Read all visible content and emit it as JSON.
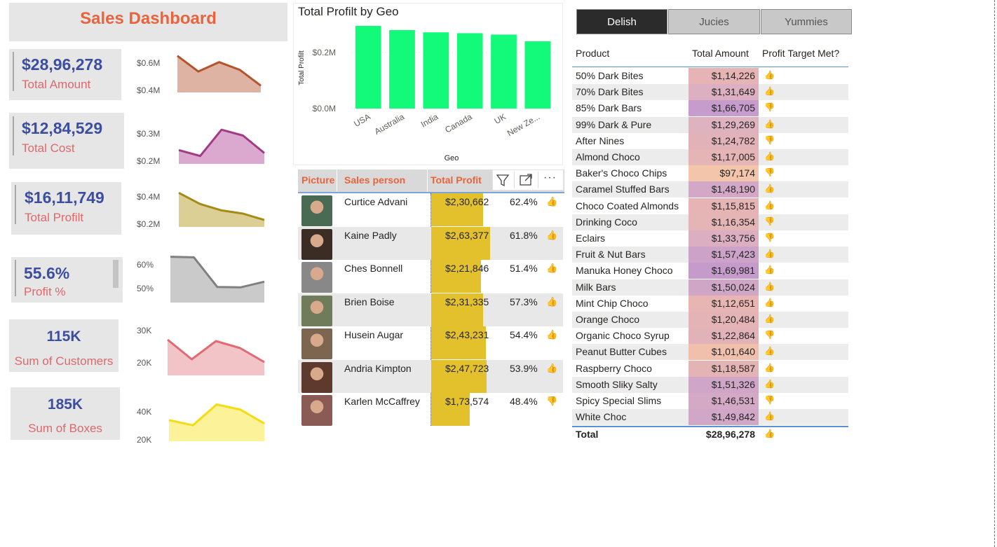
{
  "dashboard": {
    "title": "Sales Dashboard"
  },
  "kpis": [
    {
      "value": "$28,96,278",
      "label": "Total Amount"
    },
    {
      "value": "$12,84,529",
      "label": "Total Cost"
    },
    {
      "value": "$16,11,749",
      "label": "Total Profilt"
    },
    {
      "value": "55.6%",
      "label": "Profit %"
    },
    {
      "value": "115K",
      "label": "Sum of Customers"
    },
    {
      "value": "185K",
      "label": "Sum of Boxes"
    }
  ],
  "sparklines": [
    {
      "top_label": "$0.6M",
      "bottom_label": "$0.4M",
      "color": "#b5532a",
      "fill": "#dfb3a3",
      "values": [
        0.62,
        0.52,
        0.58,
        0.53,
        0.43
      ]
    },
    {
      "top_label": "$0.3M",
      "bottom_label": "$0.2M",
      "color": "#a23a86",
      "fill": "#dba9cf",
      "values": [
        0.22,
        0.2,
        0.29,
        0.27,
        0.21
      ]
    },
    {
      "top_label": "$0.4M",
      "bottom_label": "$0.2M",
      "color": "#a78a16",
      "fill": "#dccf96",
      "values": [
        0.44,
        0.37,
        0.33,
        0.31,
        0.27
      ]
    },
    {
      "top_label": "60%",
      "bottom_label": "50%",
      "color": "#808080",
      "fill": "#cacaca",
      "values": [
        0.626,
        0.624,
        0.518,
        0.517,
        0.537
      ]
    },
    {
      "top_label": "30K",
      "bottom_label": "20K",
      "color": "#e06b72",
      "fill": "#f3c4c7",
      "values": [
        27,
        20,
        26.5,
        24,
        19
      ]
    },
    {
      "top_label": "40K",
      "bottom_label": "20K",
      "color": "#f5dc10",
      "fill": "#fbf29a",
      "values": [
        35,
        32,
        44,
        41,
        33
      ]
    }
  ],
  "geo_chart": {
    "title": "Total Profilt by Geo",
    "chart_data": {
      "type": "bar",
      "title": "Total Profilt by Geo",
      "xlabel": "Geo",
      "ylabel": "Total Profilt",
      "categories": [
        "USA",
        "Australia",
        "India",
        "Canada",
        "UK",
        "New Ze..."
      ],
      "values": [
        0.295,
        0.28,
        0.272,
        0.269,
        0.264,
        0.24
      ],
      "ylim": [
        0,
        0.3
      ],
      "yticks": [
        "$0.0M",
        "$0.2M"
      ],
      "grid": true,
      "color": "#13f97a"
    }
  },
  "sales_table": {
    "headers": {
      "picture": "Picture",
      "person": "Sales person",
      "profit": "Total Profit"
    },
    "rows": [
      {
        "name": "Curtice Advani",
        "profit": "$2,30,662",
        "pct": "62.4%",
        "thumb": "👍",
        "bar": 0.877
      },
      {
        "name": "Kaine Padly",
        "profit": "$2,63,377",
        "pct": "61.8%",
        "thumb": "👍",
        "bar": 1.0
      },
      {
        "name": "Ches Bonnell",
        "profit": "$2,21,846",
        "pct": "51.4%",
        "thumb": "👍",
        "bar": 0.842
      },
      {
        "name": "Brien Boise",
        "profit": "$2,31,335",
        "pct": "57.3%",
        "thumb": "👍",
        "bar": 0.878
      },
      {
        "name": "Husein Augar",
        "profit": "$2,43,231",
        "pct": "54.4%",
        "thumb": "👍",
        "bar": 0.924
      },
      {
        "name": "Andria Kimpton",
        "profit": "$2,47,723",
        "pct": "53.9%",
        "thumb": "👍",
        "bar": 0.941
      },
      {
        "name": "Karlen McCaffrey",
        "profit": "$1,73,574",
        "pct": "48.4%",
        "thumb": "👎",
        "bar": 0.659
      }
    ],
    "photo_colors": [
      "#4a6b53",
      "#3b2c24",
      "#888888",
      "#6f7b5a",
      "#7d6650",
      "#5e3a2e",
      "#8a5a55"
    ]
  },
  "tabs": [
    "Delish",
    "Jucies",
    "Yummies"
  ],
  "product_table": {
    "headers": {
      "product": "Product",
      "amount": "Total Amount",
      "target": "Profit Target Met?"
    },
    "rows": [
      {
        "product": "50% Dark Bites",
        "amount": "$1,14,226",
        "thumb": "👍",
        "color": "#e6b4b4"
      },
      {
        "product": "70% Dark Bites",
        "amount": "$1,31,649",
        "thumb": "👍",
        "color": "#dcb0c0"
      },
      {
        "product": "85% Dark Bars",
        "amount": "$1,66,705",
        "thumb": "👎",
        "color": "#c69ccc"
      },
      {
        "product": "99% Dark & Pure",
        "amount": "$1,29,269",
        "thumb": "👍",
        "color": "#deb2bf"
      },
      {
        "product": "After Nines",
        "amount": "$1,24,782",
        "thumb": "👎",
        "color": "#e1b3b8"
      },
      {
        "product": "Almond Choco",
        "amount": "$1,17,005",
        "thumb": "👍",
        "color": "#e5b4b4"
      },
      {
        "product": "Baker's Choco Chips",
        "amount": "$97,174",
        "thumb": "👎",
        "color": "#f3c5aa"
      },
      {
        "product": "Caramel Stuffed Bars",
        "amount": "$1,48,190",
        "thumb": "👍",
        "color": "#d2a8c6"
      },
      {
        "product": "Choco Coated Almonds",
        "amount": "$1,15,815",
        "thumb": "👍",
        "color": "#e6b4b4"
      },
      {
        "product": "Drinking Coco",
        "amount": "$1,16,354",
        "thumb": "👎",
        "color": "#e5b4b4"
      },
      {
        "product": "Eclairs",
        "amount": "$1,33,756",
        "thumb": "👎",
        "color": "#dbafc1"
      },
      {
        "product": "Fruit & Nut Bars",
        "amount": "$1,57,423",
        "thumb": "👍",
        "color": "#cca2c9"
      },
      {
        "product": "Manuka Honey Choco",
        "amount": "$1,69,981",
        "thumb": "👍",
        "color": "#c59bcc"
      },
      {
        "product": "Milk Bars",
        "amount": "$1,50,024",
        "thumb": "👍",
        "color": "#d0a6c7"
      },
      {
        "product": "Mint Chip Choco",
        "amount": "$1,12,651",
        "thumb": "👍",
        "color": "#e7b5b2"
      },
      {
        "product": "Orange Choco",
        "amount": "$1,20,484",
        "thumb": "👍",
        "color": "#e3b3b6"
      },
      {
        "product": "Organic Choco Syrup",
        "amount": "$1,22,864",
        "thumb": "👎",
        "color": "#e1b3b8"
      },
      {
        "product": "Peanut Butter Cubes",
        "amount": "$1,01,640",
        "thumb": "👍",
        "color": "#f0c0ac"
      },
      {
        "product": "Raspberry Choco",
        "amount": "$1,18,587",
        "thumb": "👍",
        "color": "#e4b4b5"
      },
      {
        "product": "Smooth Sliky Salty",
        "amount": "$1,51,326",
        "thumb": "👍",
        "color": "#cfa5c8"
      },
      {
        "product": "Spicy Special Slims",
        "amount": "$1,46,531",
        "thumb": "👎",
        "color": "#d3a9c6"
      },
      {
        "product": "White Choc",
        "amount": "$1,49,842",
        "thumb": "👍",
        "color": "#d1a7c7"
      }
    ],
    "total": {
      "label": "Total",
      "amount": "$28,96,278",
      "thumb": "👍"
    }
  }
}
